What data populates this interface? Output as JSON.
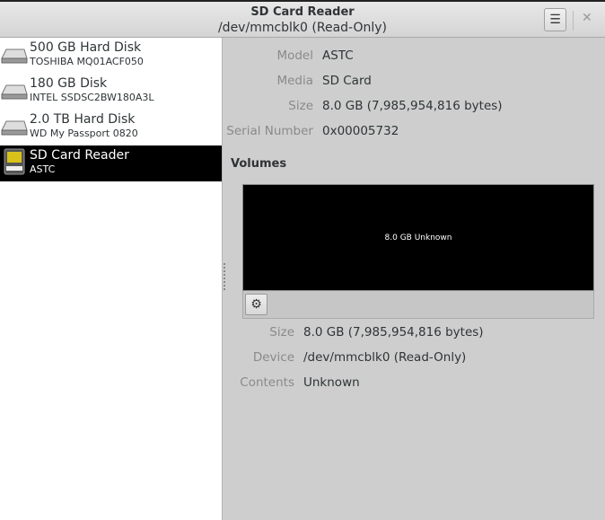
{
  "window": {
    "title": "SD Card Reader",
    "subtitle": "/dev/mmcblk0 (Read-Only)",
    "menu_icon": "hamburger-icon",
    "close_icon": "close-icon"
  },
  "sidebar": {
    "items": [
      {
        "name": "500 GB Hard Disk",
        "model": "TOSHIBA MQ01ACF050",
        "icon": "hard-disk-icon"
      },
      {
        "name": "180 GB Disk",
        "model": "INTEL SSDSC2BW180A3L",
        "icon": "hard-disk-icon"
      },
      {
        "name": "2.0 TB Hard Disk",
        "model": "WD My Passport 0820",
        "icon": "hard-disk-icon"
      },
      {
        "name": "SD Card Reader",
        "model": "ASTC",
        "icon": "sd-card-icon"
      }
    ]
  },
  "drive": {
    "model_label": "Model",
    "model": "ASTC",
    "media_label": "Media",
    "media": "SD Card",
    "size_label": "Size",
    "size": "8.0 GB (7,985,954,816 bytes)",
    "serial_label": "Serial Number",
    "serial": "0x00005732"
  },
  "volumes": {
    "heading": "Volumes",
    "block_label": "8.0 GB Unknown",
    "size_label": "Size",
    "size": "8.0 GB (7,985,954,816 bytes)",
    "device_label": "Device",
    "device": "/dev/mmcblk0 (Read-Only)",
    "contents_label": "Contents",
    "contents": "Unknown"
  }
}
